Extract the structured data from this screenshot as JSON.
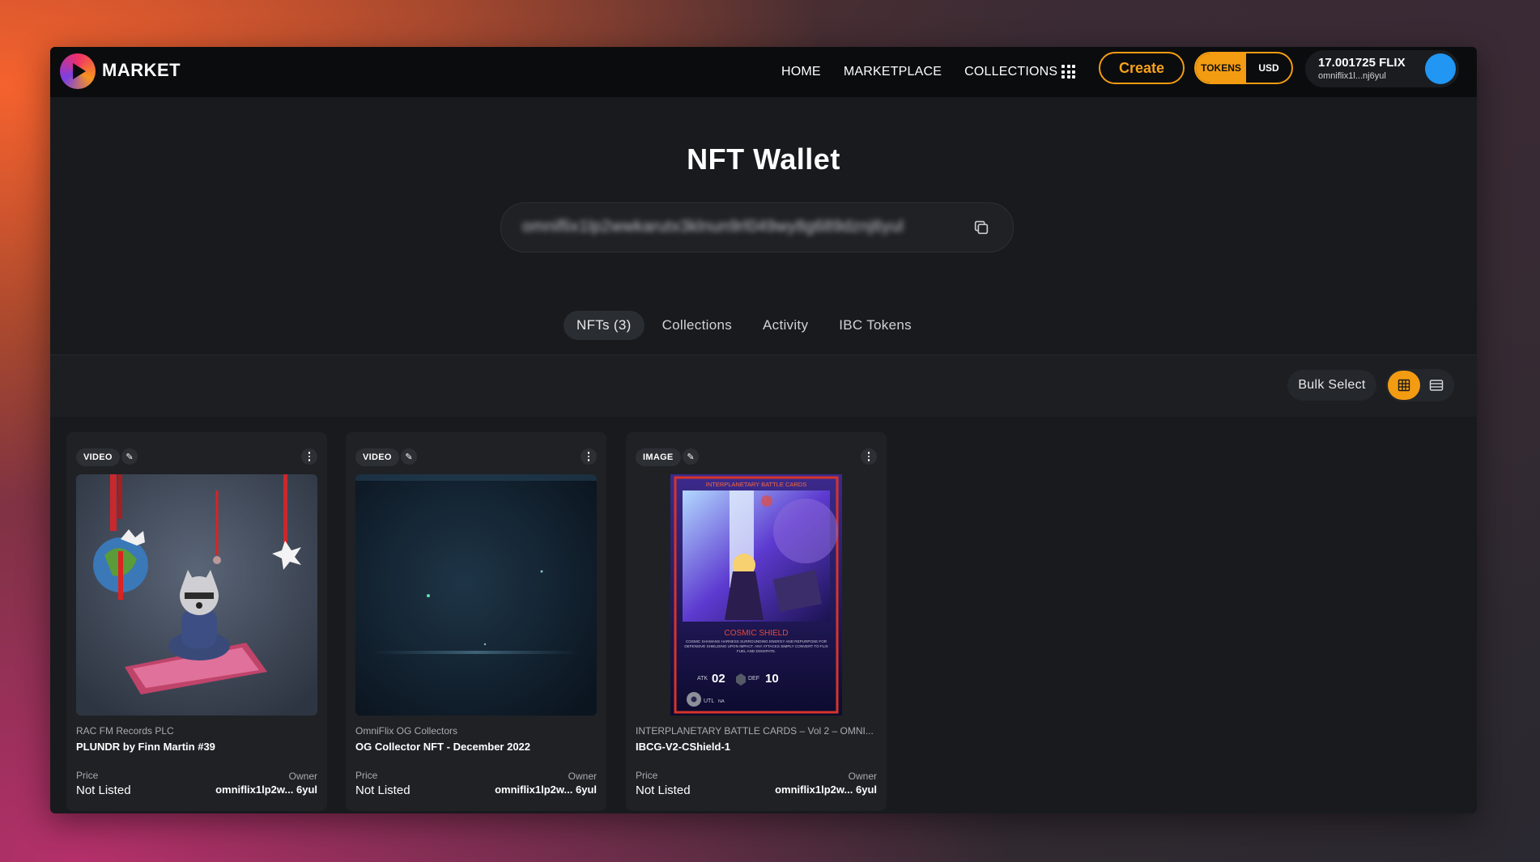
{
  "nav": {
    "brand": "MARKET",
    "links": [
      "HOME",
      "MARKETPLACE",
      "COLLECTIONS"
    ],
    "create_label": "Create",
    "currency_toggle": {
      "active": "TOKENS",
      "inactive": "USD"
    },
    "balance": "17.001725 FLIX",
    "address_short": "omniflix1l...nj6yul"
  },
  "page": {
    "title": "NFT Wallet",
    "address": "omniflix1lp2wwkarutx3klnun9rl049wy8g689dznj6yul"
  },
  "tabs": [
    "NFTs (3)",
    "Collections",
    "Activity",
    "IBC Tokens"
  ],
  "toolbar": {
    "bulk_select_label": "Bulk Select"
  },
  "cards": [
    {
      "badge": "VIDEO",
      "collection": "RAC FM Records PLC",
      "name": "PLUNDR by Finn Martin #39",
      "price_label": "Price",
      "price": "Not Listed",
      "owner_label": "Owner",
      "owner": "omniflix1lp2w... 6yul"
    },
    {
      "badge": "VIDEO",
      "collection": "OmniFlix OG Collectors",
      "name": "OG Collector NFT - December 2022",
      "price_label": "Price",
      "price": "Not Listed",
      "owner_label": "Owner",
      "owner": "omniflix1lp2w... 6yul"
    },
    {
      "badge": "IMAGE",
      "collection": "INTERPLANETARY BATTLE CARDS – Vol 2 – OMNI...",
      "name": "IBCG-V2-CShield-1",
      "price_label": "Price",
      "price": "Not Listed",
      "owner_label": "Owner",
      "owner": "omniflix1lp2w... 6yul",
      "art": {
        "header": "INTERPLANETARY BATTLE CARDS",
        "title": "COSMIC SHIELD",
        "desc": "COSMIC SHAMANS HARNESS SURROUNDING ENERGY AND REPURPOSE FOR DEFENSIVE SHIELDING UPON IMPACT. ANY ATTACKS SIMPLY CONVERT TO FLIX FUEL AND DISSIPATE.",
        "atk_label": "ATK",
        "atk": "02",
        "def_label": "DEF",
        "def": "10",
        "util_label": "UTL",
        "util": "NA"
      }
    }
  ],
  "colors": {
    "accent": "#f39c12",
    "avatar": "#2196f3"
  }
}
